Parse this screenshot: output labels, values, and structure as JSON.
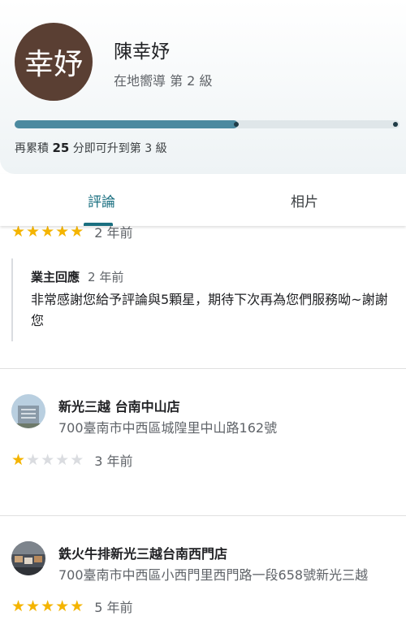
{
  "profile": {
    "avatar_text": "幸妤",
    "avatar_color": "#5a3f33",
    "name": "陳幸妤",
    "level": "在地嚮導 第 2 級"
  },
  "progress": {
    "fraction": 0.58,
    "note_prefix": "再累積",
    "note_points": "25",
    "note_suffix": "分即可升到第 3 級"
  },
  "tabs": [
    {
      "label": "評論",
      "active": true
    },
    {
      "label": "相片",
      "active": false
    }
  ],
  "reviews": [
    {
      "stars": 5,
      "ago": "2 年前",
      "reply": {
        "title": "業主回應",
        "ago": "2 年前",
        "text": "非常感謝您給予評論與5顆星，期待下次再為您們服務呦~謝謝您"
      }
    },
    {
      "place": "新光三越 台南中山店",
      "address": "700臺南市中西區城隍里中山路162號",
      "stars": 1,
      "ago": "3 年前"
    },
    {
      "place": "鉄火牛排新光三越台南西門店",
      "address": "700臺南市中西區小西門里西門路一段658號新光三越",
      "stars": 5,
      "ago": "5 年前"
    }
  ],
  "colors": {
    "accent": "#1a6f80",
    "star_on": "#f4b400",
    "star_off": "#dadce0",
    "progress_fill": "#4c8aa0"
  }
}
